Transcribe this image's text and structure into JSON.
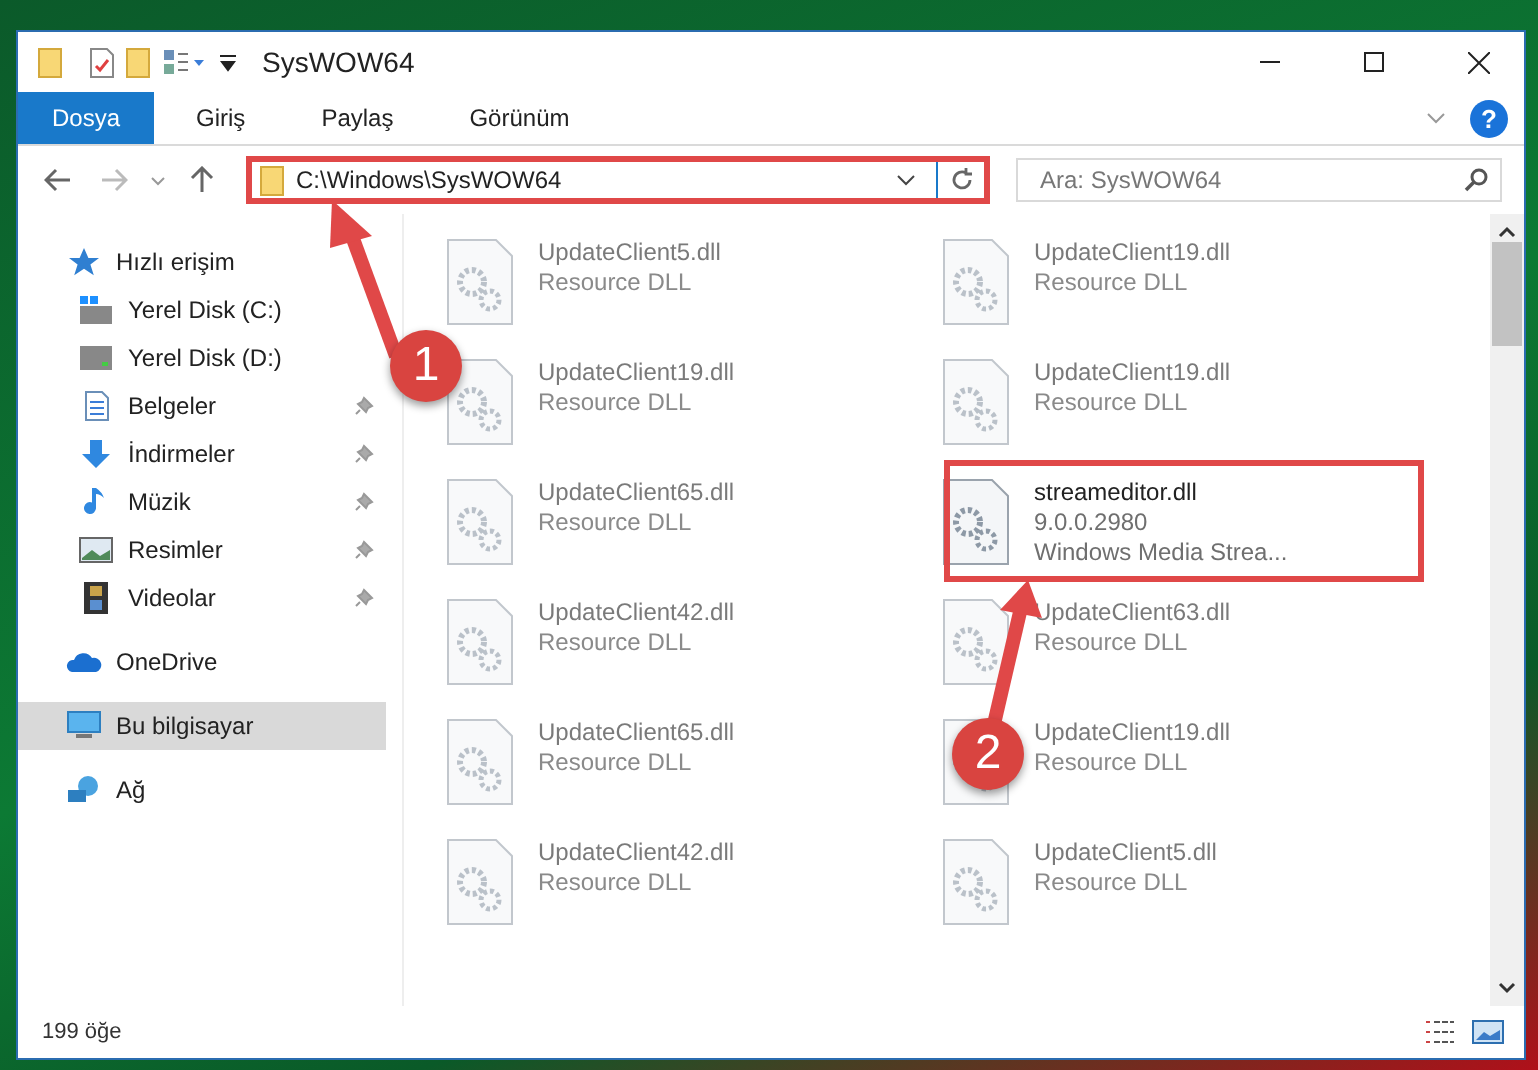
{
  "window": {
    "title": "SysWOW64"
  },
  "ribbon": {
    "tabs": [
      {
        "label": "Dosya",
        "selected": true
      },
      {
        "label": "Giriş",
        "selected": false
      },
      {
        "label": "Paylaş",
        "selected": false
      },
      {
        "label": "Görünüm",
        "selected": false
      }
    ],
    "help": "?"
  },
  "address": {
    "path": "C:\\Windows\\SysWOW64"
  },
  "search": {
    "placeholder": "Ara: SysWOW64"
  },
  "sidebar": {
    "items": [
      {
        "label": "Hızlı erişim",
        "kind": "star",
        "selected": false,
        "children": [
          {
            "label": "Yerel Disk (C:)",
            "kind": "drive-c",
            "pinned": false
          },
          {
            "label": "Yerel Disk (D:)",
            "kind": "drive",
            "pinned": false
          },
          {
            "label": "Belgeler",
            "kind": "documents",
            "pinned": true
          },
          {
            "label": "İndirmeler",
            "kind": "download",
            "pinned": true
          },
          {
            "label": "Müzik",
            "kind": "music",
            "pinned": true
          },
          {
            "label": "Resimler",
            "kind": "pictures",
            "pinned": true
          },
          {
            "label": "Videolar",
            "kind": "videos",
            "pinned": true
          }
        ]
      },
      {
        "label": "OneDrive",
        "kind": "cloud",
        "selected": false
      },
      {
        "label": "Bu bilgisayar",
        "kind": "computer",
        "selected": true
      },
      {
        "label": "Ağ",
        "kind": "network",
        "selected": false
      }
    ]
  },
  "files": [
    {
      "name": "UpdateClient5.dll",
      "details": [
        "Resource DLL"
      ],
      "blurred": true
    },
    {
      "name": "UpdateClient19.dll",
      "details": [
        "Resource DLL"
      ],
      "blurred": true
    },
    {
      "name": "UpdateClient19.dll",
      "details": [
        "Resource DLL"
      ],
      "blurred": true
    },
    {
      "name": "UpdateClient19.dll",
      "details": [
        "Resource DLL"
      ],
      "blurred": true
    },
    {
      "name": "UpdateClient65.dll",
      "details": [
        "Resource DLL"
      ],
      "blurred": true
    },
    {
      "name": "streameditor.dll",
      "details": [
        "9.0.0.2980",
        "Windows Media Strea..."
      ],
      "blurred": false
    },
    {
      "name": "UpdateClient42.dll",
      "details": [
        "Resource DLL"
      ],
      "blurred": true
    },
    {
      "name": "UpdateClient63.dll",
      "details": [
        "Resource DLL"
      ],
      "blurred": true
    },
    {
      "name": "UpdateClient65.dll",
      "details": [
        "Resource DLL"
      ],
      "blurred": true
    },
    {
      "name": "UpdateClient19.dll",
      "details": [
        "Resource DLL"
      ],
      "blurred": true
    },
    {
      "name": "UpdateClient42.dll",
      "details": [
        "Resource DLL"
      ],
      "blurred": true
    },
    {
      "name": "UpdateClient5.dll",
      "details": [
        "Resource DLL"
      ],
      "blurred": true
    }
  ],
  "status_bar": {
    "count": "199 öğe"
  },
  "annotations": [
    {
      "label": "1"
    },
    {
      "label": "2"
    }
  ]
}
